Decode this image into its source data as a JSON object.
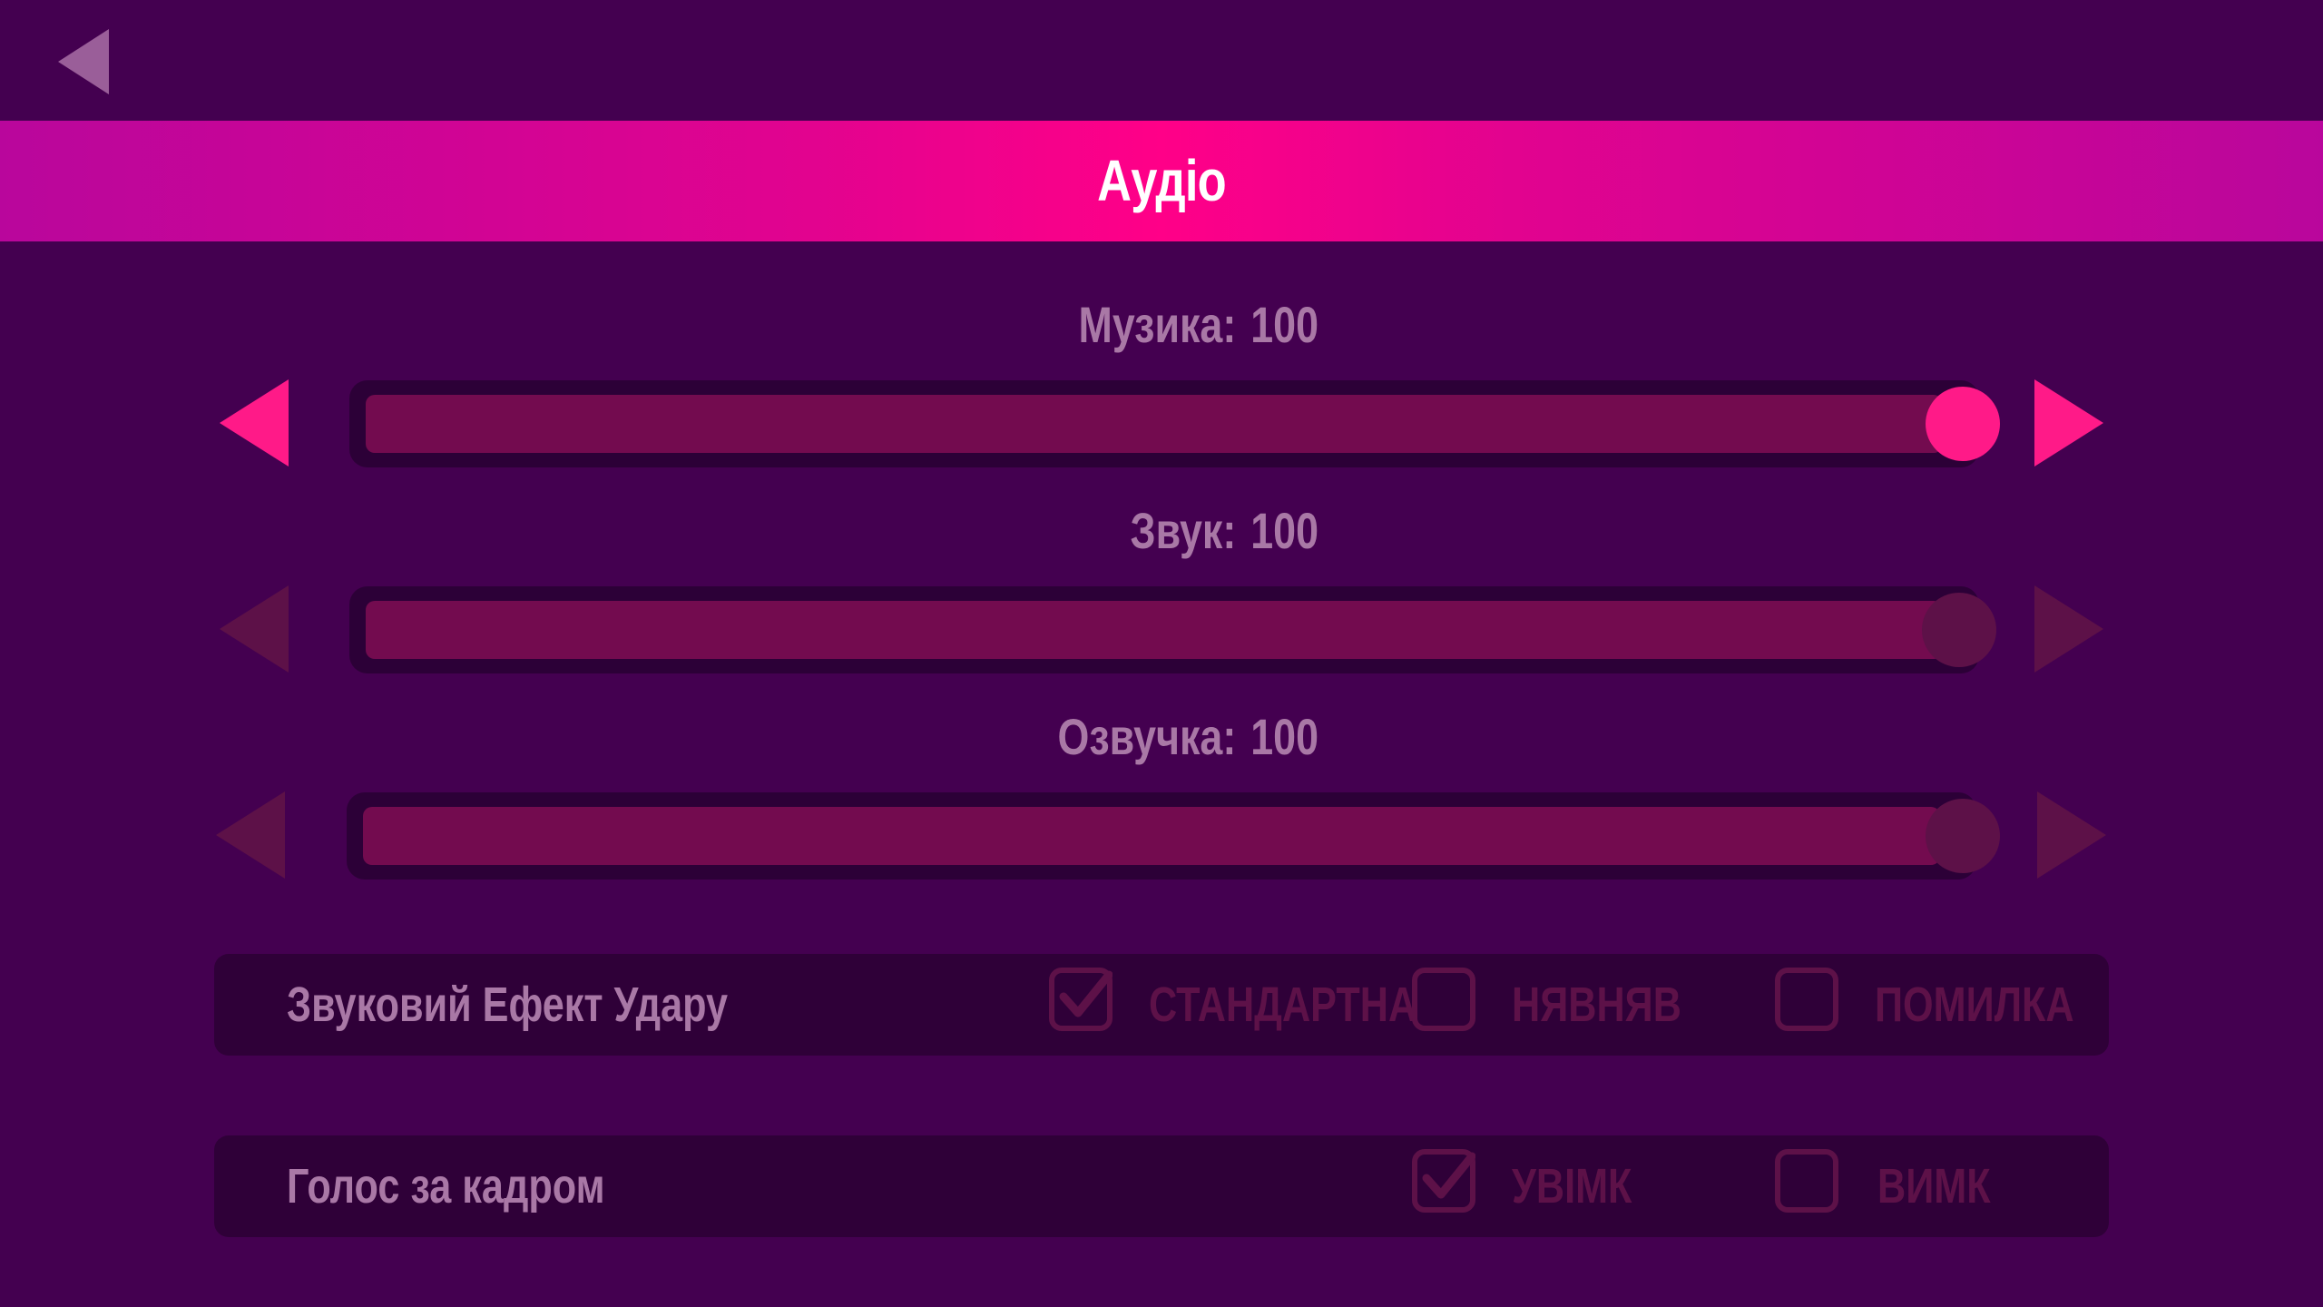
{
  "title": "Аудіо",
  "back_icon": "back-arrow-icon",
  "colors": {
    "background": "#440050",
    "accent": "#ff1a88",
    "dim_accent": "#5d1148",
    "label": "#a978a6",
    "track": "#2c0037",
    "fill": "#730b4f"
  },
  "sliders": [
    {
      "label": "Музика:",
      "value": "100",
      "level": 1.0,
      "active": true
    },
    {
      "label": "Звук:",
      "value": "100",
      "level": 1.0,
      "active": false
    },
    {
      "label": "Озвучка:",
      "value": "100",
      "level": 1.0,
      "active": false
    }
  ],
  "hit_effect": {
    "label": "Звуковий Ефект Удару",
    "options": [
      {
        "label": "СТАНДАРТНА",
        "checked": true
      },
      {
        "label": "НЯВНЯВ",
        "checked": false
      },
      {
        "label": "ПОМИЛКА",
        "checked": false
      }
    ]
  },
  "voiceover": {
    "label": "Голос за кадром",
    "options": [
      {
        "label": "УВІМК",
        "checked": true
      },
      {
        "label": "ВИМК",
        "checked": false
      }
    ]
  }
}
